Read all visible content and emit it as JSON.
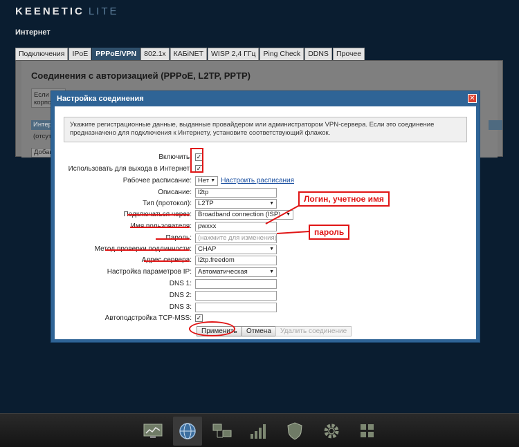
{
  "header": {
    "brand": "KEENETIC",
    "edition": "LITE",
    "page_title": "Интернет"
  },
  "tabs": [
    {
      "label": "Подключения",
      "active": false
    },
    {
      "label": "IPoE",
      "active": false
    },
    {
      "label": "PPPoE/VPN",
      "active": true
    },
    {
      "label": "802.1x",
      "active": false
    },
    {
      "label": "КАБiNET",
      "active": false
    },
    {
      "label": "WISP 2,4 ГГц",
      "active": false
    },
    {
      "label": "Ping Check",
      "active": false
    },
    {
      "label": "DDNS",
      "active": false
    },
    {
      "label": "Прочее",
      "active": false
    }
  ],
  "panel": {
    "title": "Соединения с авторизацией (PPPoE, L2TP, PPTP)",
    "note_fragment": "Если д корпо",
    "table_head_fragment": "Интерф",
    "table_cell_fragment": "(отсутст",
    "add_button_fragment": "Добави"
  },
  "modal": {
    "title": "Настройка соединения",
    "close": "✕",
    "info": "Укажите регистрационные данные, выданные провайдером или администратором VPN-сервера. Если это соединение предназначено для подключения к Интернету, установите соответствующий флажок.",
    "fields": {
      "enable": {
        "label": "Включить:",
        "checked": true
      },
      "use_for_internet": {
        "label": "Использовать для выхода в Интернет:",
        "checked": true
      },
      "schedule": {
        "label": "Рабочее расписание:",
        "value": "Нет",
        "link": "Настроить расписания"
      },
      "description": {
        "label": "Описание:",
        "value": "l2tp"
      },
      "protocol": {
        "label": "Тип (протокол):",
        "value": "L2TP"
      },
      "connect_via": {
        "label": "Подключаться через:",
        "value": "Broadband connection (ISP)"
      },
      "username": {
        "label": "Имя пользователя:",
        "value": "pwxxx"
      },
      "password": {
        "label": "Пароль:",
        "placeholder": "(нажмите для изменения)"
      },
      "auth_method": {
        "label": "Метод проверки подлинности:",
        "value": "CHAP"
      },
      "server": {
        "label": "Адрес сервера:",
        "value": "l2tp.freedom"
      },
      "ip_settings": {
        "label": "Настройка параметров IP:",
        "value": "Автоматическая"
      },
      "dns1": {
        "label": "DNS 1:",
        "value": ""
      },
      "dns2": {
        "label": "DNS 2:",
        "value": ""
      },
      "dns3": {
        "label": "DNS 3:",
        "value": ""
      },
      "tcp_mss": {
        "label": "Автоподстройка TCP-MSS:",
        "checked": true
      }
    },
    "buttons": {
      "apply": "Применить",
      "cancel": "Отмена",
      "delete": "Удалить соединение"
    }
  },
  "annotations": {
    "login_callout": "Логин, учетное имя",
    "password_callout": "пароль",
    "color": "#e01515"
  },
  "taskbar": {
    "icons": [
      {
        "name": "monitor-chart-icon",
        "active": false
      },
      {
        "name": "globe-icon",
        "active": true
      },
      {
        "name": "network-computers-icon",
        "active": false
      },
      {
        "name": "signal-bars-icon",
        "active": false
      },
      {
        "name": "shield-icon",
        "active": false
      },
      {
        "name": "gear-icon",
        "active": false
      },
      {
        "name": "apps-grid-icon",
        "active": false
      }
    ]
  },
  "colors": {
    "background": "#0a1d30",
    "modal_header": "#2f6496",
    "active_tab": "#2f4f6b"
  }
}
